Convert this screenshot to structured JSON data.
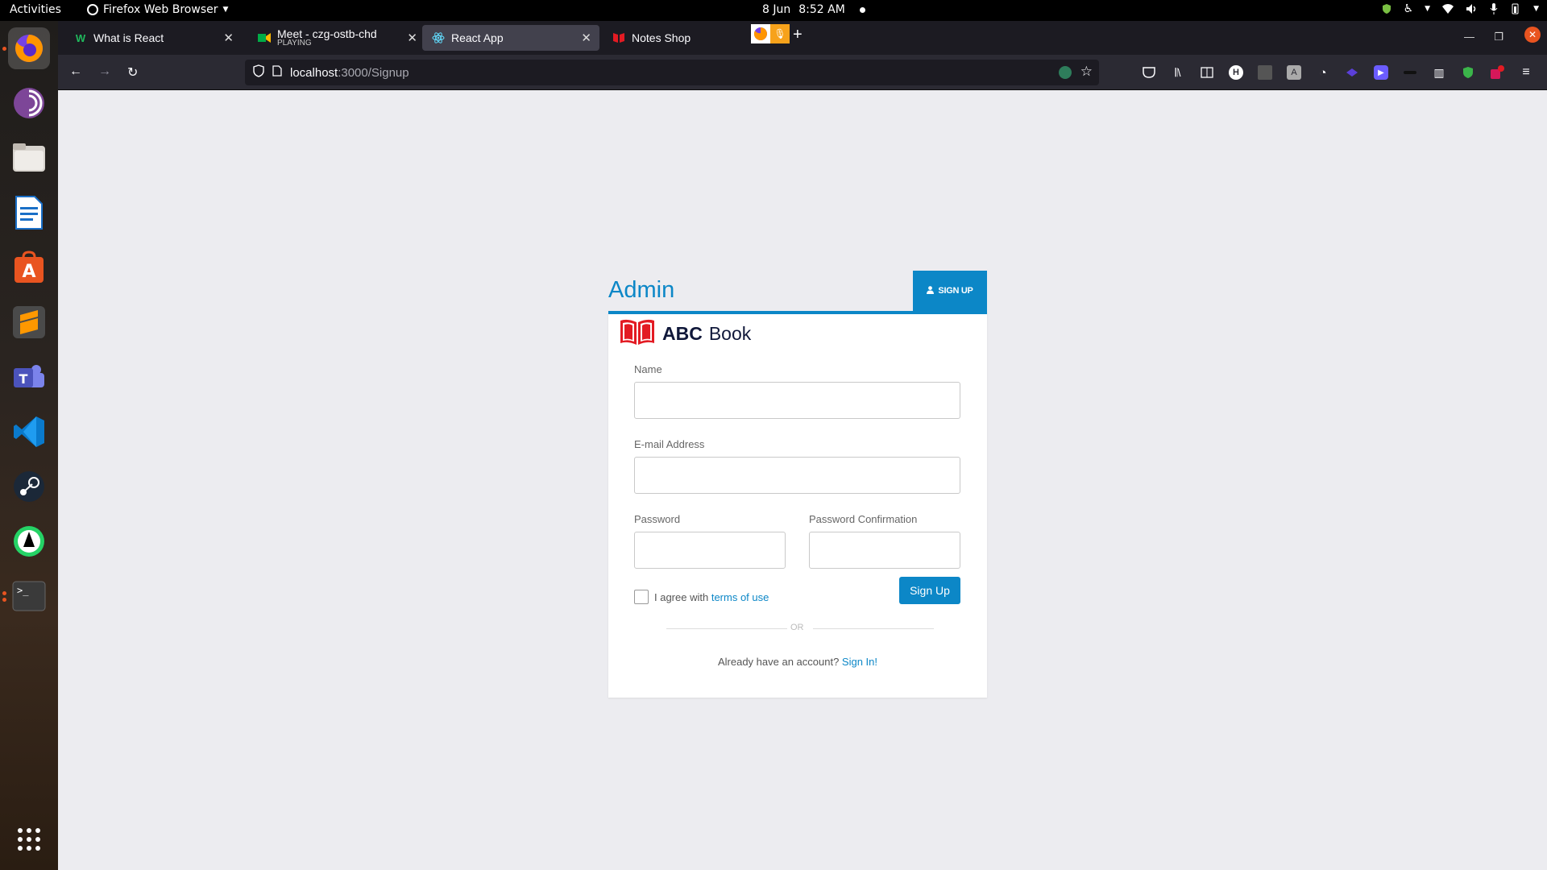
{
  "topbar": {
    "activities": "Activities",
    "app_name": "Firefox Web Browser",
    "date": "8 Jun",
    "time": "8:52 AM"
  },
  "dock": {
    "items": [
      "firefox",
      "tor-browser",
      "files",
      "libreoffice-writer",
      "ubuntu-software",
      "sublime-text",
      "teams",
      "vscode",
      "steam",
      "whatsapp",
      "terminal",
      "show-apps"
    ]
  },
  "tabs": [
    {
      "title": "What is React",
      "icon": "w-icon"
    },
    {
      "title": "Meet - czg-ostb-chd",
      "subtitle": "PLAYING",
      "icon": "meet-icon"
    },
    {
      "title": "React App",
      "icon": "react-icon",
      "active": true
    },
    {
      "title": "Notes Shop",
      "icon": "book-icon"
    }
  ],
  "url": {
    "host": "localhost",
    "path": ":3000/Signup"
  },
  "page": {
    "admin_title": "Admin",
    "signup_tab": "SIGN UP",
    "brand_bold": "ABC",
    "brand_light": "Book",
    "name_label": "Name",
    "email_label": "E-mail Address",
    "password_label": "Password",
    "password_confirm_label": "Password Confirmation",
    "agree_text": "I agree with",
    "terms_link": "terms of use",
    "signup_button": "Sign Up",
    "or_text": "OR",
    "already_text": "Already have an account?",
    "signin_link": "Sign In!"
  },
  "colors": {
    "accent": "#0c87c7",
    "brand_red": "#e31b23"
  }
}
